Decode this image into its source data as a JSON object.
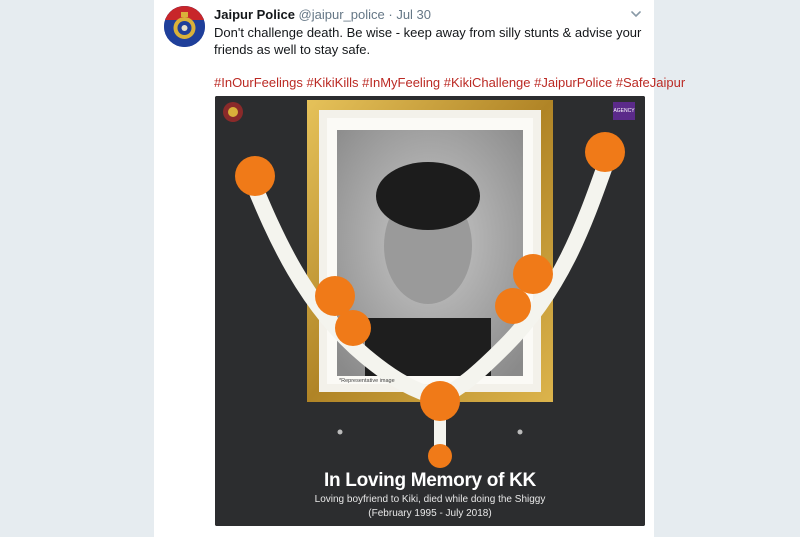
{
  "tweet": {
    "author_name": "Jaipur Police",
    "author_handle": "@jaipur_police",
    "separator": "·",
    "timestamp": "Jul 30",
    "text": "Don't challenge death. Be wise - keep away from silly stunts & advise your friends as well to stay safe.",
    "hashtags": [
      "#InOurFeelings",
      "#KikiKills",
      "#InMyFeeling",
      "#KikiChallenge",
      "#JaipurPolice",
      "#SafeJaipur"
    ]
  },
  "media": {
    "caption_title": "In Loving Memory of KK",
    "caption_subtitle": "Loving boyfriend to Kiki, died while doing the Shiggy",
    "caption_dates": "(February 1995 - July 2018)",
    "representative_note": "*Representative image",
    "badge_text": "AGENCY",
    "colors": {
      "background": "#2c2d2f",
      "frame_gold": "#c9a23c",
      "marigold": "#f07a18",
      "jasmine": "#f4f4ee",
      "hashtag": "#bb2a24"
    }
  },
  "icons": {
    "avatar": "police-emblem-icon",
    "menu": "chevron-down-icon"
  }
}
